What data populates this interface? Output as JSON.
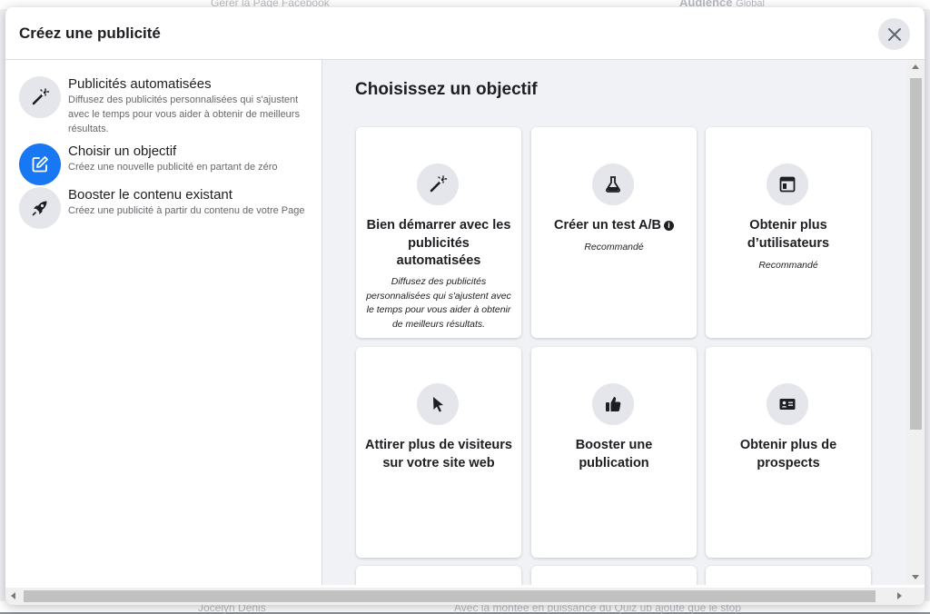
{
  "background": {
    "top_left_text": "Gérer la Page Facebook",
    "top_right_label": "Audience",
    "top_right_value": "Global",
    "bottom_left_text": "Jocelyn Denis",
    "bottom_right_text": "Avec la montée en puissance du Quiz ub ajouté que le stop"
  },
  "modal": {
    "title": "Créez une publicité"
  },
  "sidebar": {
    "items": [
      {
        "title": "Publicités automatisées",
        "desc": "Diffusez des publicités personnalisées qui s'ajustent avec le temps pour vous aider à obtenir de meilleurs résultats.",
        "icon": "magic-wand-icon"
      },
      {
        "title": "Choisir un objectif",
        "desc": "Créez une nouvelle publicité en partant de zéro",
        "icon": "edit-icon"
      },
      {
        "title": "Booster le contenu existant",
        "desc": "Créez une publicité à partir du contenu de votre Page",
        "icon": "rocket-icon"
      }
    ]
  },
  "main": {
    "title": "Choisissez un objectif",
    "cards": [
      {
        "title": "Bien démarrer avec les publicités automatisées",
        "sub": "Diffusez des publicités personnalisées qui s'ajustent avec le temps pour vous aider à obtenir de meilleurs résultats.",
        "icon": "magic-wand-icon"
      },
      {
        "title": "Créer un test A/B",
        "sub": "Recommandé",
        "icon": "flask-icon"
      },
      {
        "title": "Obtenir plus d’utilisateurs",
        "sub": "Recommandé",
        "icon": "app-window-icon"
      },
      {
        "title": "Attirer plus de visiteurs sur votre site web",
        "sub": "",
        "icon": "cursor-icon"
      },
      {
        "title": "Booster une publication",
        "sub": "",
        "icon": "thumbs-up-icon"
      },
      {
        "title": "Obtenir plus de prospects",
        "sub": "",
        "icon": "contact-card-icon"
      }
    ]
  },
  "colors": {
    "accent": "#1877f2",
    "icon_bg": "#e4e6eb",
    "panel_bg": "#f0f2f5"
  }
}
